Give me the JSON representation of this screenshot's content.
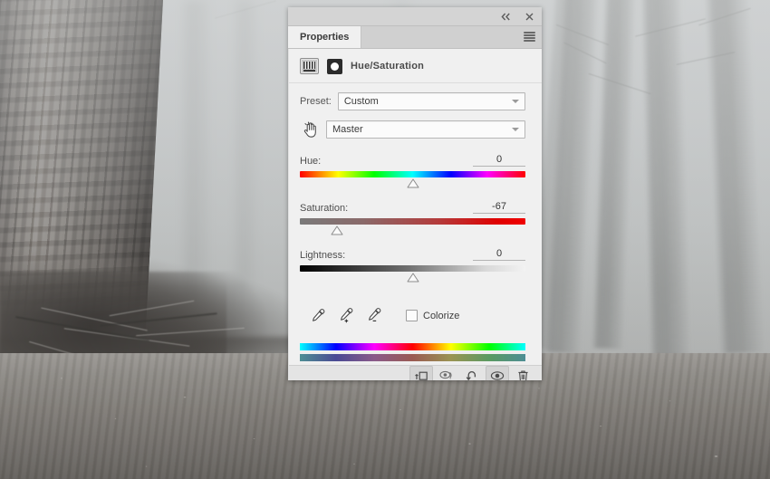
{
  "window": {
    "collapse_icon": "double-chevron-left-icon",
    "close_icon": "close-icon",
    "menu_icon": "panel-menu-icon"
  },
  "tabs": [
    {
      "label": "Properties",
      "active": true
    }
  ],
  "adjustment": {
    "type_icon": "hue-saturation-adjustment-icon",
    "mask_icon": "layer-mask-icon",
    "title": "Hue/Saturation"
  },
  "preset": {
    "label": "Preset:",
    "value": "Custom"
  },
  "channel": {
    "targeted_adjustment_icon": "on-image-adjustment-hand-icon",
    "value": "Master"
  },
  "sliders": [
    {
      "name": "Hue:",
      "value": "0",
      "thumb_percent": 50,
      "track": "hue-spectrum"
    },
    {
      "name": "Saturation:",
      "value": "-67",
      "thumb_percent": 16.5,
      "track": "saturation-gray-to-red"
    },
    {
      "name": "Lightness:",
      "value": "0",
      "thumb_percent": 50,
      "track": "lightness-black-to-white"
    }
  ],
  "tools": {
    "eyedropper": "eyedropper-icon",
    "eyedropper_add": "eyedropper-add-icon",
    "eyedropper_subtract": "eyedropper-subtract-icon",
    "colorize_label": "Colorize",
    "colorize_checked": false
  },
  "color_range_bars": {
    "top_bar": "color-range-source-bar",
    "bottom_bar": "color-range-result-bar"
  },
  "footer_buttons": [
    {
      "name": "clip-to-layer-button",
      "icon": "clip-to-layer-icon",
      "active": true
    },
    {
      "name": "toggle-previous-state-button",
      "icon": "eye-with-arrow-icon",
      "active": false
    },
    {
      "name": "reset-adjustment-button",
      "icon": "reset-arrow-icon",
      "active": false
    },
    {
      "name": "toggle-layer-visibility-button",
      "icon": "eye-icon",
      "active": true
    },
    {
      "name": "delete-adjustment-button",
      "icon": "trash-icon",
      "active": false
    }
  ],
  "colors": {
    "panel_bg": "#f0f0f0",
    "tabstrip_bg": "#d0d0d0",
    "footer_bg": "#e4e4e4",
    "text": "#4b4b4b"
  }
}
